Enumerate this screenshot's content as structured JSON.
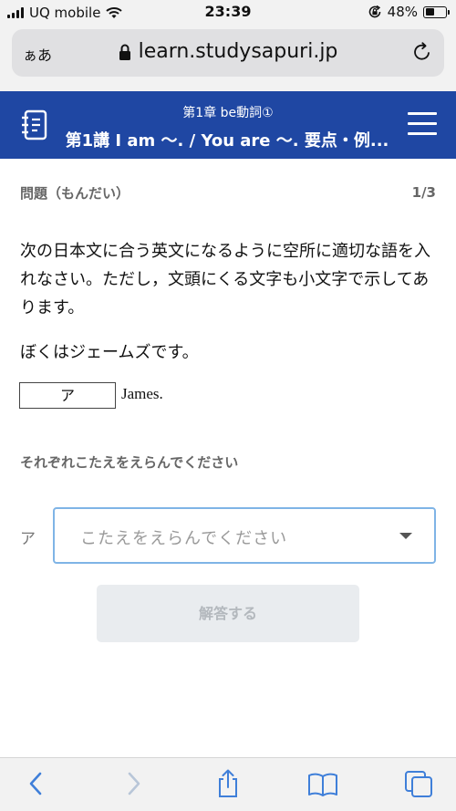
{
  "status_bar": {
    "carrier": "UQ mobile",
    "time": "23:39",
    "battery_percent": "48%",
    "battery_level": 0.48,
    "icons": [
      "signal-icon",
      "wifi-icon",
      "orientation-lock-icon",
      "battery-icon"
    ]
  },
  "browser": {
    "aa_label": "ぁあ",
    "url": "learn.studysapuri.jp",
    "icons": [
      "lock-icon",
      "reload-icon"
    ]
  },
  "header": {
    "chapter": "第1章 be動詞①",
    "title": "第1講 I am 〜. / You are 〜. 要点・例...",
    "background": "#1f47a3",
    "icons": [
      "notebook-icon",
      "hamburger-menu-icon"
    ]
  },
  "question": {
    "label": "問題（もんだい）",
    "page": "1/3",
    "instruction": "次の日本文に合う英文になるように空所に適切な語を入れなさい。ただし，文頭にくる文字も小文字で示してあります。",
    "sentence_jp": "ぼくはジェームズです。",
    "blank_label": "ア",
    "sentence_rest": "James."
  },
  "answer": {
    "heading": "それぞれこたえをえらんでください",
    "select_label": "ア",
    "select_placeholder": "こたえをえらんでください",
    "submit_label": "解答する",
    "accent": "#7fb4e6"
  },
  "toolbar": {
    "icons": [
      "back-icon",
      "forward-icon",
      "share-icon",
      "bookmarks-icon",
      "tabs-icon"
    ]
  }
}
